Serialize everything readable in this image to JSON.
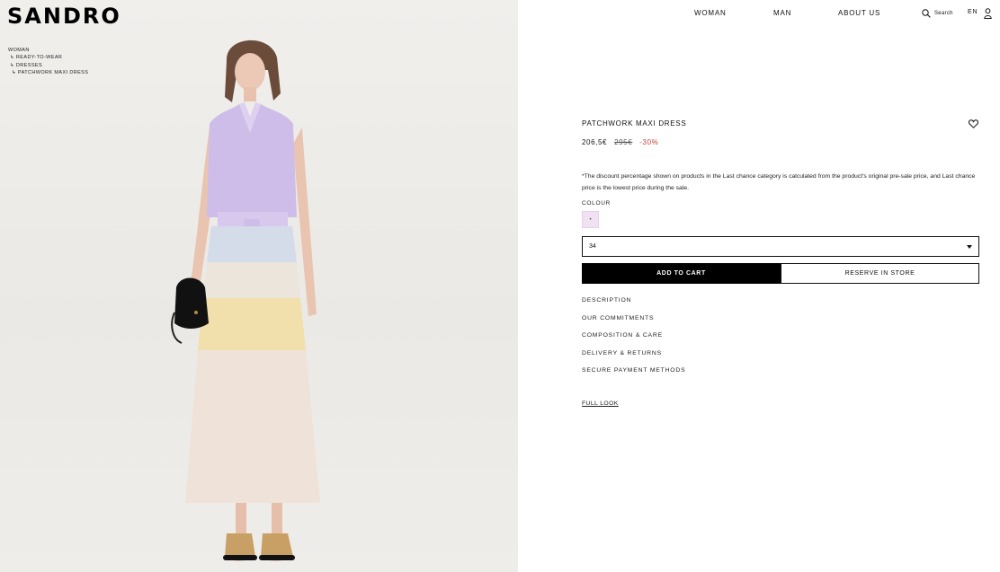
{
  "brand": {
    "logo": "SANDRO"
  },
  "breadcrumb": {
    "level0": "WOMAN",
    "level1": "↳ READY-TO-WEAR",
    "level2": "↳ DRESSES",
    "level3": "↳ PATCHWORK MAXI DRESS"
  },
  "nav": {
    "woman": "WOMAN",
    "man": "MAN",
    "about": "ABOUT US",
    "search": "Search",
    "lang": "EN"
  },
  "product": {
    "title": "PATCHWORK MAXI DRESS",
    "price": "206,5€",
    "old_price": "295€",
    "discount": "-30%",
    "note": "*The discount percentage shown on products in the Last chance category is calculated from the product's original pre-sale price, and Last chance price is the lowest price during the sale.",
    "colour_label": "COLOUR",
    "swatch_mark": "•",
    "size_value": "34",
    "add_to_cart": "ADD TO CART",
    "reserve_in_store": "RESERVE IN STORE"
  },
  "accordion": [
    "DESCRIPTION",
    "OUR COMMITMENTS",
    "COMPOSITION & CARE",
    "DELIVERY & RETURNS",
    "SECURE PAYMENT METHODS"
  ],
  "full_look": "FULL LOOK",
  "colors": {
    "discount": "#c2433b",
    "add_to_cart_bg": "#000000",
    "swatch": "#f0e1f3",
    "photo_bg": "#eeece9"
  }
}
